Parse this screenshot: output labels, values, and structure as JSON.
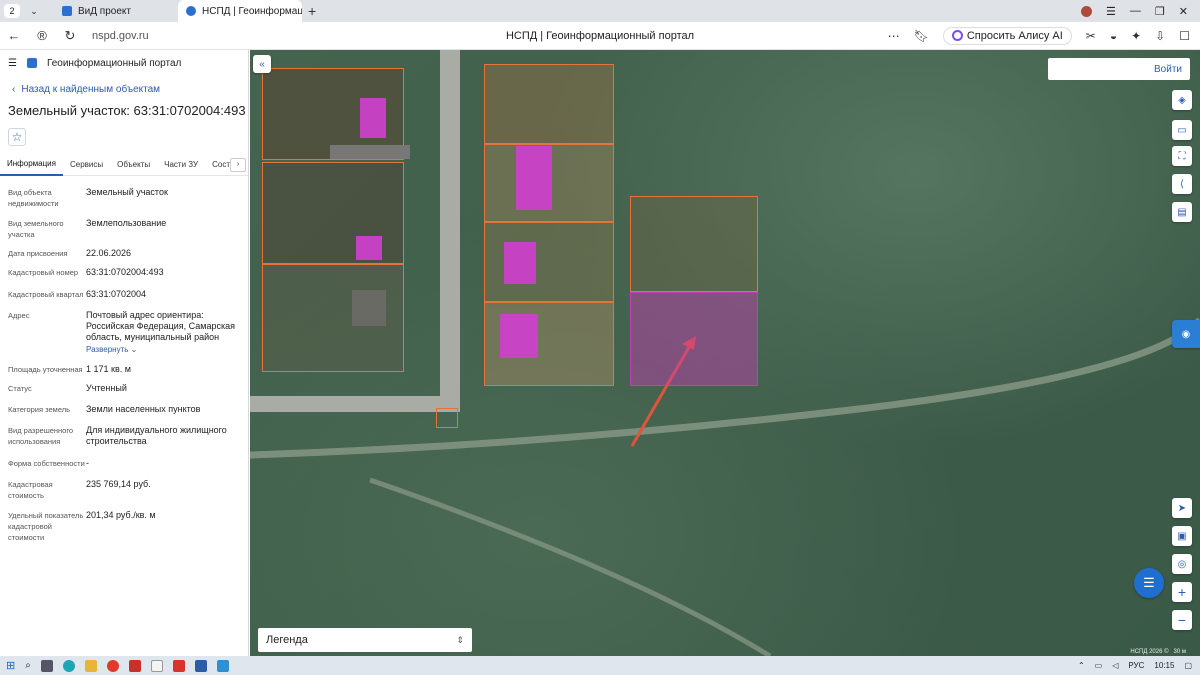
{
  "browser": {
    "tab_count": "2",
    "tabs": [
      {
        "title": "ВиД проект"
      },
      {
        "title": "НСПД | Геоинформацио"
      }
    ],
    "url": "nspd.gov.ru",
    "page_title": "НСПД | Геоинформационный портал",
    "alice_label": "Спросить Алису AI"
  },
  "sidebar": {
    "app_title": "Геоинформационный портал",
    "back_label": "Назад к найденным объектам",
    "object_title": "Земельный участок: 63:31:0702004:493",
    "tabs": [
      "Информация",
      "Сервисы",
      "Объекты",
      "Части ЗУ",
      "Состав"
    ],
    "fields": [
      {
        "key": "Вид объекта недвижимости",
        "value": "Земельный участок"
      },
      {
        "key": "Вид земельного участка",
        "value": "Землепользование"
      },
      {
        "key": "Дата присвоения",
        "value": "22.06.2026"
      },
      {
        "key": "Кадастровый номер",
        "value": "63:31:0702004:493"
      },
      {
        "key": "Кадастровый квартал",
        "value": "63:31:0702004"
      },
      {
        "key": "Адрес",
        "value": "Почтовый адрес ориентира: Российская Федерация, Самарская область, муниципальный район"
      },
      {
        "key": "Площадь уточненная",
        "value": "1 171 кв. м"
      },
      {
        "key": "Статус",
        "value": "Учтенный"
      },
      {
        "key": "Категория земель",
        "value": "Земли населенных пунктов"
      },
      {
        "key": "Вид разрешенного использования",
        "value": "Для индивидуального жилищного строительства"
      },
      {
        "key": "Форма собственности",
        "value": "-"
      },
      {
        "key": "Кадастровая стоимость",
        "value": "235 769,14 руб."
      },
      {
        "key": "Удельный показатель кадастровой стоимости",
        "value": "201,34 руб./кв. м"
      }
    ],
    "expand_label": "Развернуть"
  },
  "map": {
    "login_label": "Войти",
    "legend_label": "Легенда",
    "copyright": "НСПД 2026 ©",
    "scale_label": "30 м",
    "colors": {
      "parcel_outline": "#e4743a",
      "building": "#d03fd0",
      "selected": "#c83cb4",
      "arrow": "#e0553a"
    }
  },
  "taskbar": {
    "lang": "РУС",
    "time": "10:15"
  }
}
